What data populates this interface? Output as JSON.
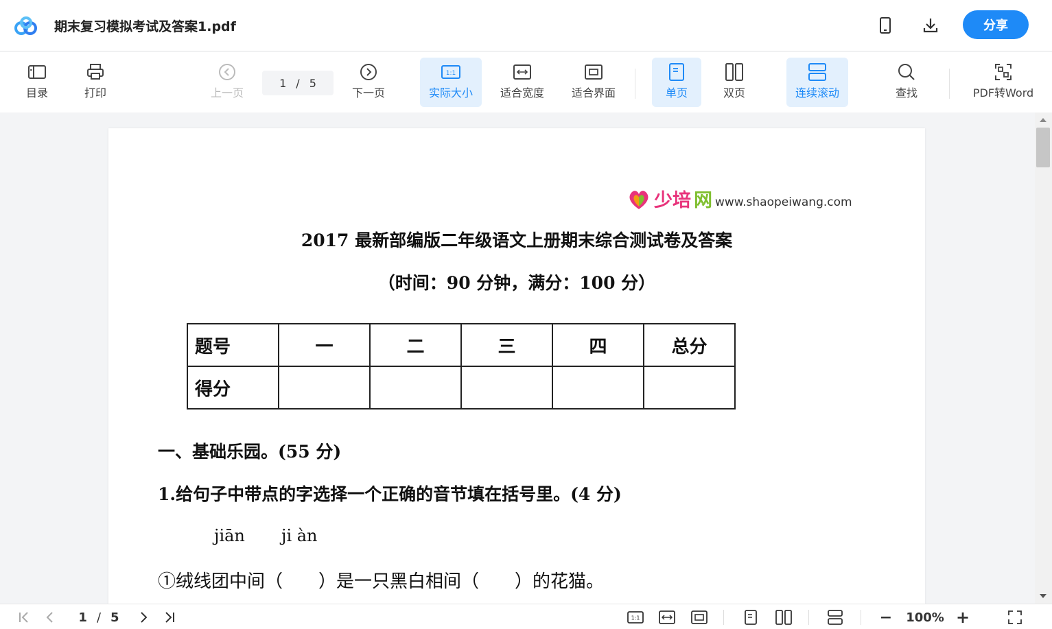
{
  "header": {
    "file_name": "期末复习模拟考试及答案1.pdf",
    "share_label": "分享",
    "icons": [
      "baidu-netdisk-logo",
      "mobile-icon",
      "download-icon"
    ]
  },
  "toolbar": {
    "toc": "目录",
    "print": "打印",
    "prev": "上一页",
    "page_current": "1",
    "page_sep": "/",
    "page_total": "5",
    "next": "下一页",
    "actual_size": "实际大小",
    "fit_width": "适合宽度",
    "fit_page": "适合界面",
    "single_page": "单页",
    "double_page": "双页",
    "continuous": "连续滚动",
    "find": "查找",
    "pdf_to_word": "PDF转Word",
    "accent_color": "#1e8af7"
  },
  "document": {
    "brand_cn_1": "少培",
    "brand_cn_2": "网",
    "brand_url": "www.shaopeiwang.com",
    "title": "2017 最新部编版二年级语文上册期末综合测试卷及答案",
    "subtitle": "（时间：90 分钟，满分：100 分）",
    "score_table": {
      "header": [
        "题号",
        "一",
        "二",
        "三",
        "四",
        "总分"
      ],
      "row": [
        "得分",
        "",
        "",
        "",
        "",
        ""
      ]
    },
    "section1": "一、基础乐园。(55 分)",
    "q1": "1.给句子中带点的字选择一个正确的音节填在括号里。(4 分)",
    "pinyin_1": "jiān",
    "pinyin_2": "ji àn",
    "q1_line": "①绒线团中间（　　）是一只黑白相间（　　）的花猫。"
  },
  "statusbar": {
    "page_current": "1",
    "page_sep": "/",
    "page_total": "5",
    "zoom": "100%",
    "zoom_minus": "−",
    "zoom_plus": "+"
  }
}
